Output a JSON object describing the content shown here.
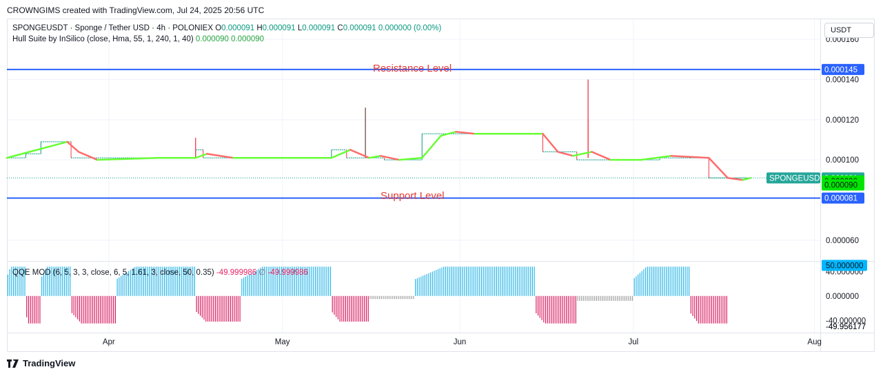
{
  "header": "CROWNGIMS created with TradingView.com, Jul 24, 2025 20:56 UTC",
  "legend": {
    "symbol": "SPONGEUSDT · Sponge / Tether USD · 4h · POLONIEX",
    "o_label": "O",
    "o_val": "0.000091",
    "h_label": "H",
    "h_val": "0.000091",
    "l_label": "L",
    "l_val": "0.000091",
    "c_label": "C",
    "c_val": "0.000091",
    "change": "0.000000 (0.00%)",
    "hull": "Hull Suite by InSilico (close, Hma, 55, 1, 240, 1, 40)",
    "hull_v1": "0.000090",
    "hull_v2": "0.000090",
    "qqe": "QQE MOD (6, 5, 3, 3, close, 6, 5, 1.61, 3, close, 50, 0.35)",
    "qqe_v1": "-49.999986",
    "qqe_v2": "∅",
    "qqe_v3": "-49.999986"
  },
  "unit_button": "USDT",
  "annotations": {
    "resistance": "Resistance Level",
    "support": "Support Level"
  },
  "footer": "TradingView",
  "colors": {
    "up": "#089981",
    "down": "#f23645",
    "hull_up": "#66ff33",
    "hull_down": "#ff6b6b",
    "level": "#2962ff",
    "qqe_up": "#2cb6e6",
    "qqe_down": "#d81b60",
    "qqe_neutral": "#9e9e9e"
  },
  "chart_data": [
    {
      "type": "line",
      "name": "price",
      "x_ticks": [
        "Apr",
        "May",
        "Jun",
        "Jul",
        "Aug"
      ],
      "y_ticks": [
        "0.000160",
        "0.000140",
        "0.000120",
        "0.000100",
        "0.000060"
      ],
      "ylim": [
        5e-05,
        0.00017
      ],
      "step_line": [
        [
          0,
          0.000101
        ],
        [
          0.025,
          0.000103
        ],
        [
          0.045,
          0.000109
        ],
        [
          0.085,
          0.000101
        ],
        [
          0.25,
          0.000105
        ],
        [
          0.26,
          0.000101
        ],
        [
          0.43,
          0.000105
        ],
        [
          0.45,
          0.000101
        ],
        [
          0.5,
          0.0001
        ],
        [
          0.55,
          0.000113
        ],
        [
          0.71,
          0.000104
        ],
        [
          0.755,
          0.0001
        ],
        [
          0.865,
          0.000101
        ],
        [
          0.905,
          0.000101
        ],
        [
          0.93,
          9.1e-05
        ],
        [
          0.985,
          9.1e-05
        ]
      ],
      "wicks": [
        [
          0.25,
          0.000111
        ],
        [
          0.475,
          0.000126
        ],
        [
          0.77,
          0.00014
        ],
        [
          0.77,
          0.00012
        ]
      ],
      "hull": [
        [
          0,
          0.000101
        ],
        [
          0.03,
          0.000104
        ],
        [
          0.05,
          0.000106
        ],
        [
          0.08,
          0.000109
        ],
        [
          0.095,
          0.000104
        ],
        [
          0.12,
          0.0001
        ],
        [
          0.2,
          0.000101
        ],
        [
          0.25,
          0.000101
        ],
        [
          0.265,
          0.000103
        ],
        [
          0.3,
          0.000101
        ],
        [
          0.43,
          0.000101
        ],
        [
          0.455,
          0.000105
        ],
        [
          0.48,
          0.000101
        ],
        [
          0.495,
          0.000102
        ],
        [
          0.52,
          0.0001
        ],
        [
          0.55,
          0.000101
        ],
        [
          0.575,
          0.000112
        ],
        [
          0.595,
          0.000114
        ],
        [
          0.62,
          0.000113
        ],
        [
          0.71,
          0.000113
        ],
        [
          0.73,
          0.000104
        ],
        [
          0.75,
          0.000102
        ],
        [
          0.775,
          0.000104
        ],
        [
          0.8,
          0.0001
        ],
        [
          0.84,
          0.0001
        ],
        [
          0.88,
          0.000102
        ],
        [
          0.93,
          0.000101
        ],
        [
          0.955,
          9.1e-05
        ],
        [
          0.975,
          9e-05
        ],
        [
          0.985,
          9.1e-05
        ]
      ],
      "resistance": 0.000145,
      "support": 8.1e-05,
      "price_labels": [
        {
          "text": "0.000145",
          "value": 0.000145,
          "style": "level"
        },
        {
          "text": "SPONGEUSDT",
          "value": 9.1e-05,
          "style": "symbol"
        },
        {
          "text": "0.000091",
          "value": 9.1e-05,
          "style": "price"
        },
        {
          "text": "0.000090",
          "value": 8.95e-05,
          "style": "hull"
        },
        {
          "text": "0.000090",
          "value": 8.75e-05,
          "style": "hull"
        },
        {
          "text": "0.000081",
          "value": 8.1e-05,
          "style": "level"
        }
      ]
    },
    {
      "type": "bar",
      "name": "qqe",
      "y_ticks": [
        "40.000000",
        "0.000000",
        "-40.000000",
        "-49.956177"
      ],
      "ylim": [
        -60,
        55
      ],
      "segments": [
        {
          "x0": 0,
          "x1": 0.025,
          "value": 48,
          "color": "up"
        },
        {
          "x0": 0.025,
          "x1": 0.045,
          "value": -45,
          "color": "down"
        },
        {
          "x0": 0.045,
          "x1": 0.085,
          "value": 48,
          "color": "up"
        },
        {
          "x0": 0.085,
          "x1": 0.145,
          "value": -45,
          "color": "down"
        },
        {
          "x0": 0.145,
          "x1": 0.25,
          "value": 48,
          "color": "up"
        },
        {
          "x0": 0.25,
          "x1": 0.31,
          "value": -42,
          "color": "down"
        },
        {
          "x0": 0.31,
          "x1": 0.43,
          "value": 48,
          "color": "up"
        },
        {
          "x0": 0.43,
          "x1": 0.48,
          "value": -42,
          "color": "down"
        },
        {
          "x0": 0.48,
          "x1": 0.54,
          "value": -5,
          "color": "neutral"
        },
        {
          "x0": 0.54,
          "x1": 0.7,
          "value": 48,
          "color": "up"
        },
        {
          "x0": 0.7,
          "x1": 0.755,
          "value": -45,
          "color": "down"
        },
        {
          "x0": 0.755,
          "x1": 0.83,
          "value": -8,
          "color": "neutral"
        },
        {
          "x0": 0.83,
          "x1": 0.905,
          "value": 48,
          "color": "up"
        },
        {
          "x0": 0.905,
          "x1": 0.955,
          "value": -45,
          "color": "down"
        }
      ],
      "price_labels": [
        {
          "text": "50.000000",
          "value": 50,
          "style": "qqe"
        },
        {
          "text": "-49.956177",
          "value": -50,
          "style": "plain"
        }
      ]
    }
  ]
}
